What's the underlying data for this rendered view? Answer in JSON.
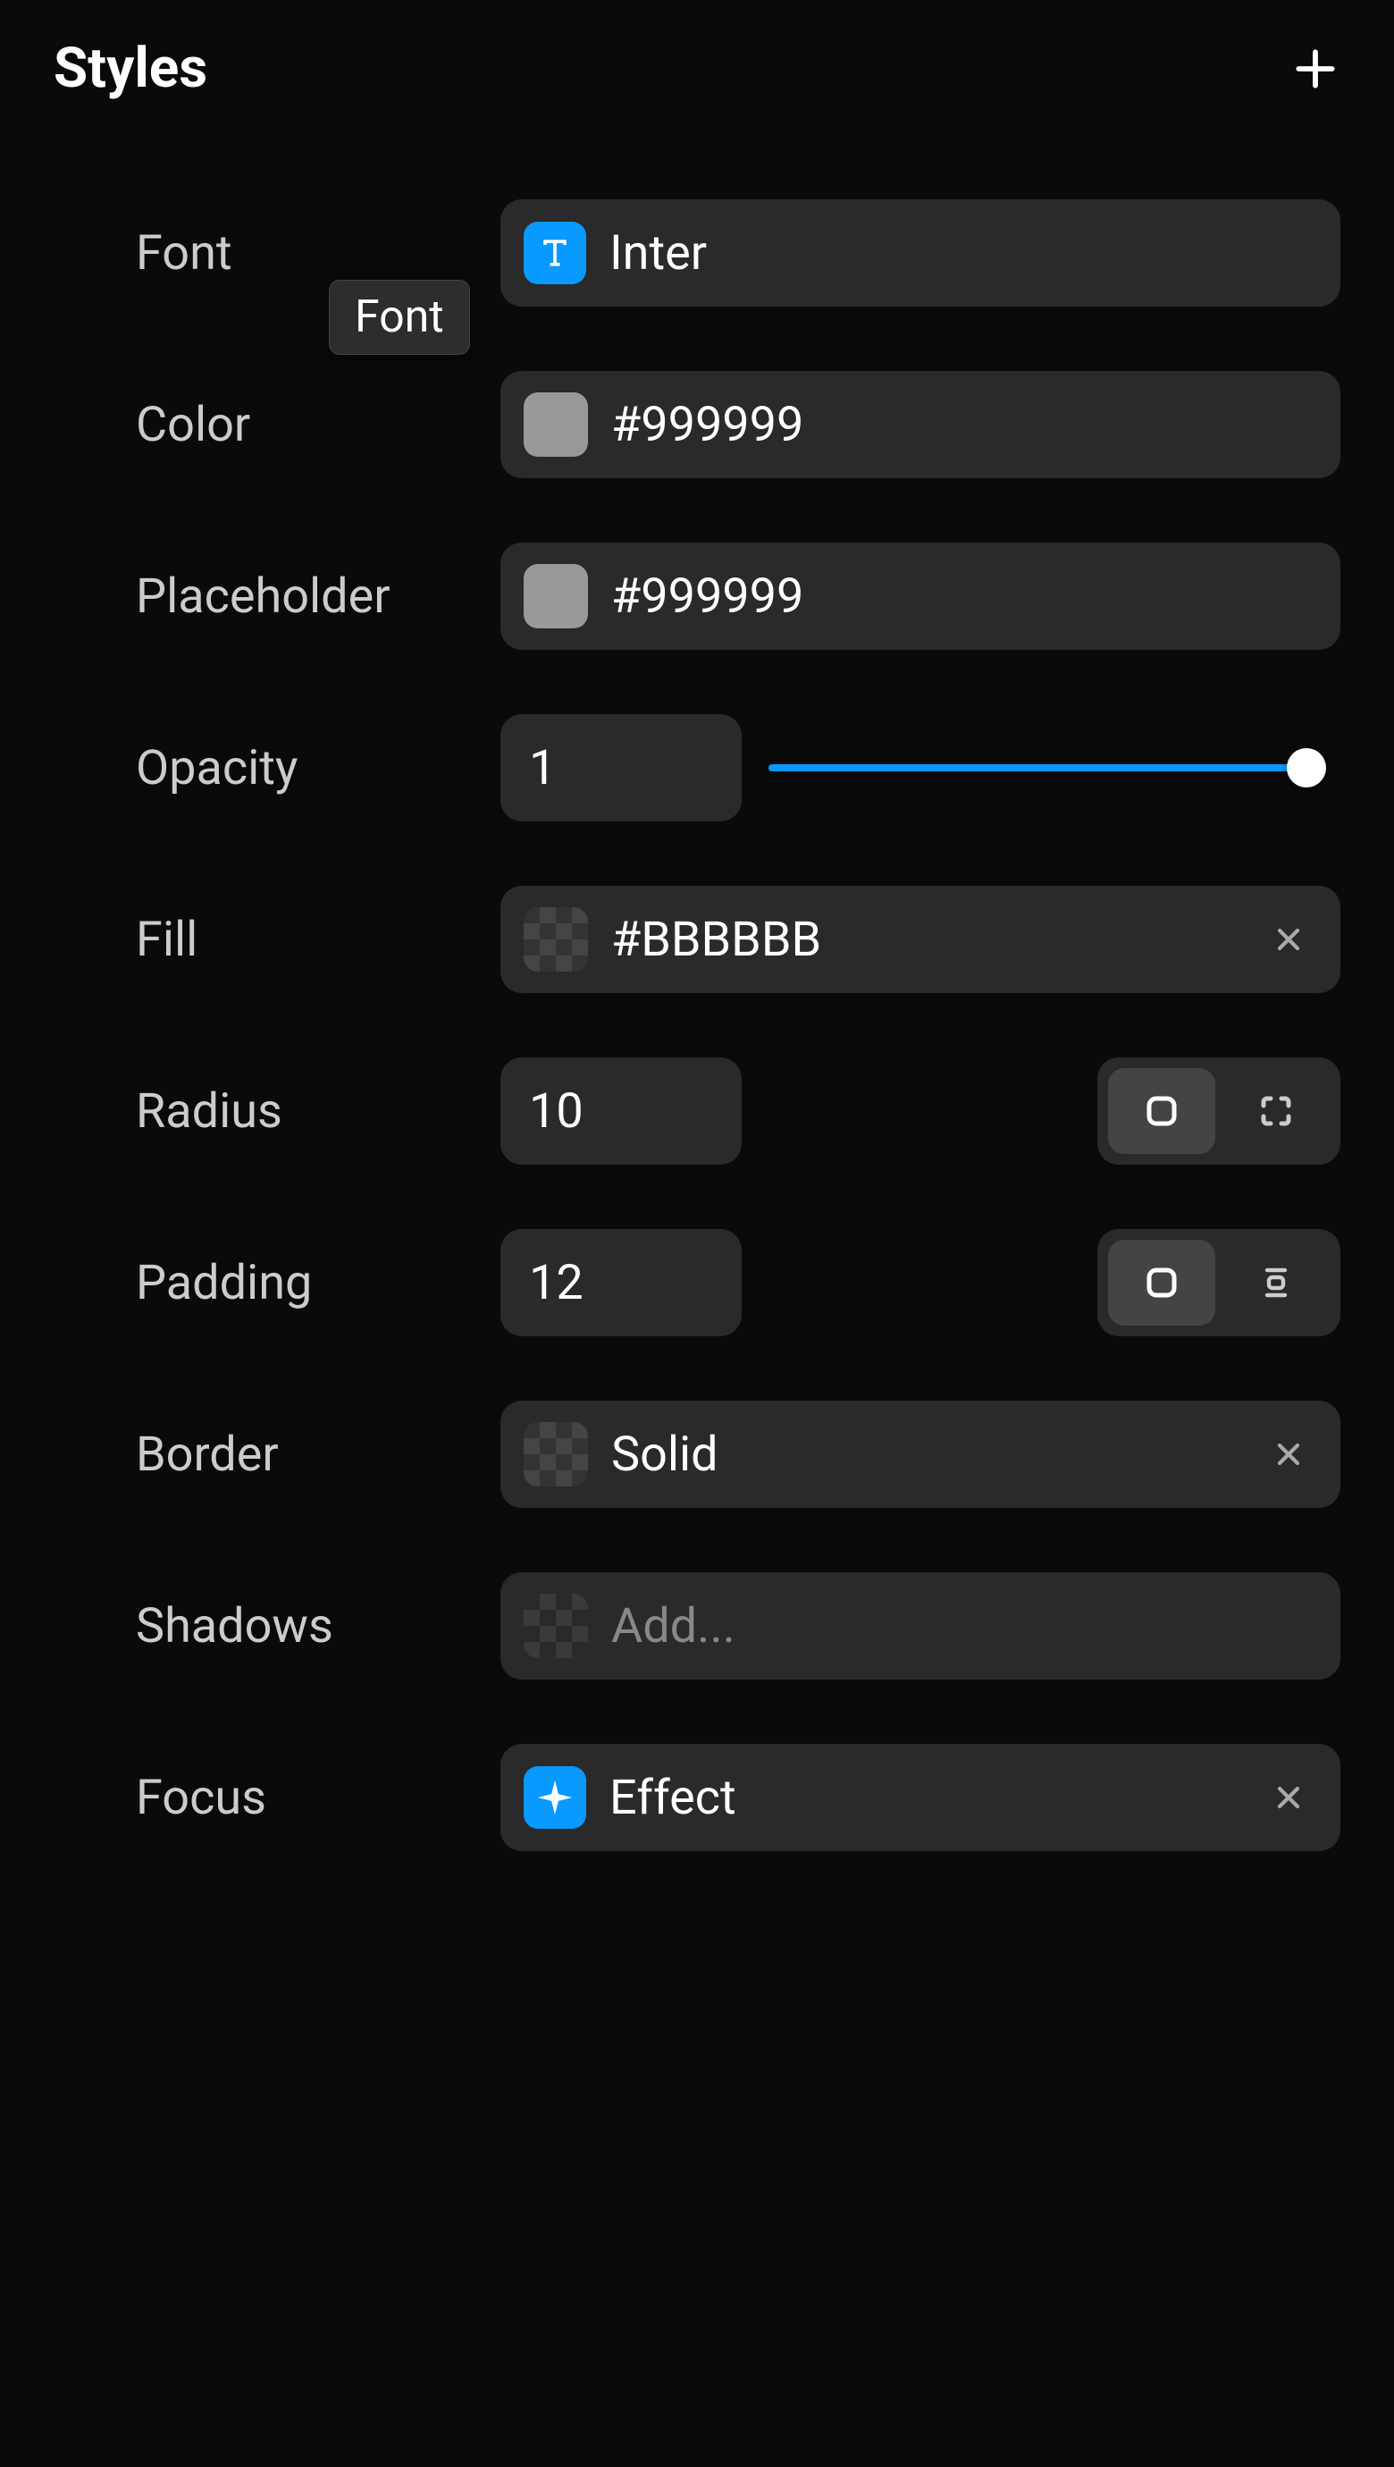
{
  "header": {
    "title": "Styles"
  },
  "tooltip": {
    "font": "Font"
  },
  "rows": {
    "font": {
      "label": "Font",
      "value": "Inter"
    },
    "color": {
      "label": "Color",
      "value": "#999999",
      "swatch": "#999999"
    },
    "placeholder": {
      "label": "Placeholder",
      "value": "#999999",
      "swatch": "#999999"
    },
    "opacity": {
      "label": "Opacity",
      "value": "1",
      "slider": 1
    },
    "fill": {
      "label": "Fill",
      "value": "#BBBBBB"
    },
    "radius": {
      "label": "Radius",
      "value": "10"
    },
    "padding": {
      "label": "Padding",
      "value": "12"
    },
    "border": {
      "label": "Border",
      "value": "Solid"
    },
    "shadows": {
      "label": "Shadows",
      "placeholder": "Add..."
    },
    "focus": {
      "label": "Focus",
      "value": "Effect"
    }
  }
}
